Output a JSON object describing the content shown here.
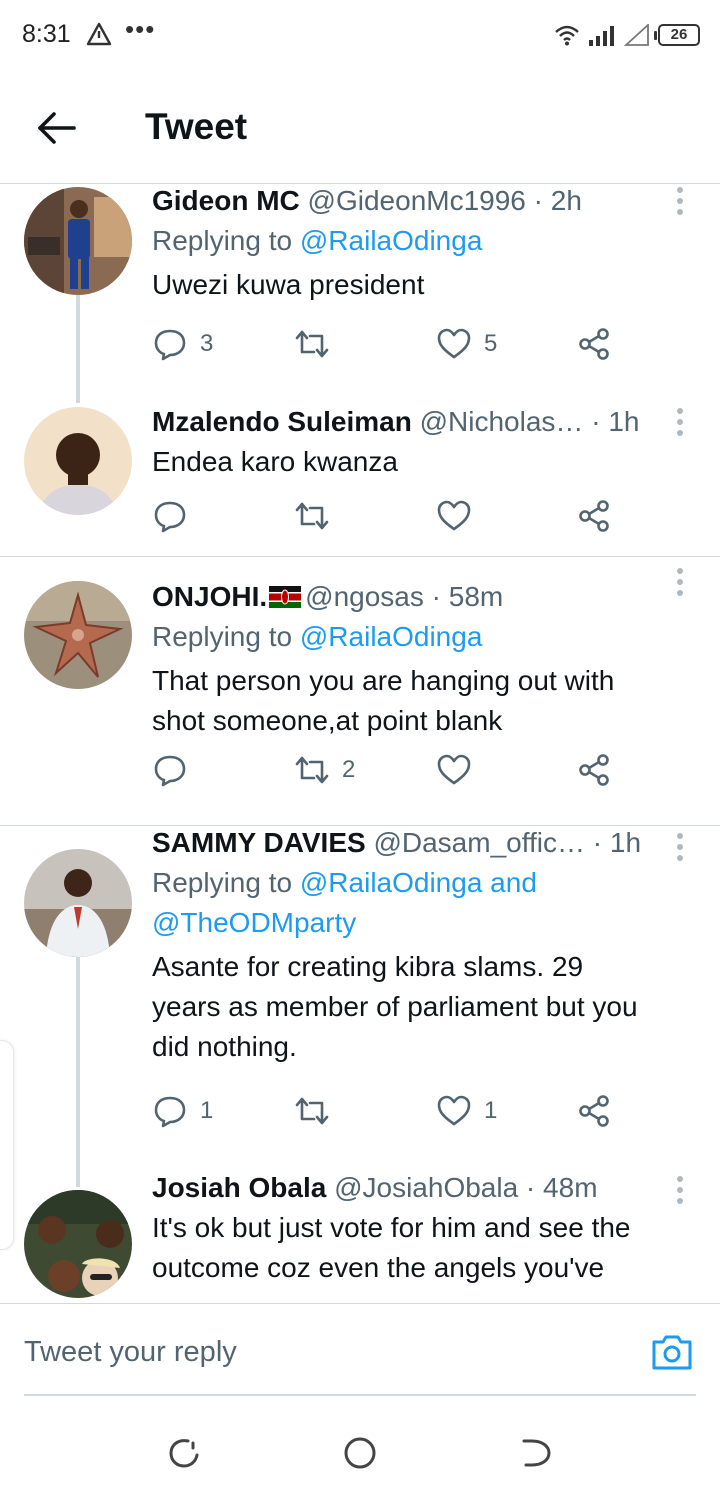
{
  "status_bar": {
    "time": "8:31",
    "battery": "26"
  },
  "header": {
    "title": "Tweet"
  },
  "tweets": [
    {
      "name": "Gideon MC",
      "handle": "@GideonMc1996",
      "time": "2h",
      "replying_prefix": "Replying to ",
      "replying_to": "@RailaOdinga",
      "text": "Uwezi kuwa president",
      "replies": "3",
      "retweets": "",
      "likes": "5"
    },
    {
      "name": "Mzalendo Suleiman",
      "handle": "@Nicholas…",
      "time": "1h",
      "text": "Endea karo kwanza",
      "replies": "",
      "retweets": "",
      "likes": ""
    },
    {
      "name": "ONJOHI.",
      "handle": "@ngosas",
      "time": "58m",
      "replying_prefix": "Replying to ",
      "replying_to": "@RailaOdinga",
      "text_lines": [
        "That person you are hanging out with",
        "shot someone,at point blank"
      ],
      "replies": "",
      "retweets": "2",
      "likes": ""
    },
    {
      "name": "SAMMY DAVIES",
      "handle": "@Dasam_offic…",
      "time": "1h",
      "replying_prefix": "Replying to ",
      "replying_to_lines": [
        "@RailaOdinga and",
        "@TheODMparty"
      ],
      "text_lines": [
        "Asante for creating kibra slams. 29",
        "years as member of parliament but you",
        "did nothing."
      ],
      "replies": "1",
      "retweets": "",
      "likes": "1"
    },
    {
      "name": "Josiah Obala",
      "handle": "@JosiahObala",
      "time": "48m",
      "text_lines": [
        "It's ok but just vote for him and see the",
        "outcome coz even the angels you've"
      ]
    }
  ],
  "reply_box": {
    "placeholder": "Tweet your reply"
  },
  "icons": {
    "reply": "reply-icon",
    "retweet": "retweet-icon",
    "like": "heart-icon",
    "share": "share-icon",
    "more": "more-vertical-icon",
    "camera": "camera-icon"
  },
  "colors": {
    "accent": "#1d9bf0",
    "text": "#0f1419",
    "muted": "#536471",
    "divider": "#cfd9de"
  }
}
